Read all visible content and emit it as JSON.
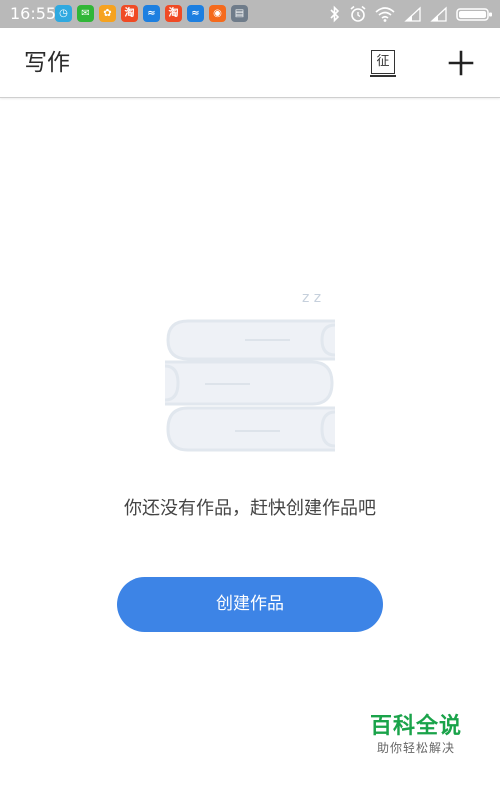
{
  "status_bar": {
    "time": "16:55",
    "notifications": [
      {
        "icon": "clock-app-icon",
        "color": "#2fa9e0",
        "glyph": "◷"
      },
      {
        "icon": "wechat-icon",
        "color": "#30b637",
        "glyph": "✉"
      },
      {
        "icon": "wallet-app-icon",
        "color": "#f6a21f",
        "glyph": "✿"
      },
      {
        "icon": "taobao-icon",
        "color": "#f04a24",
        "glyph": "淘"
      },
      {
        "icon": "alipay-icon",
        "color": "#1d7fe0",
        "glyph": "≈"
      },
      {
        "icon": "taobao-icon",
        "color": "#f04a24",
        "glyph": "淘"
      },
      {
        "icon": "alipay-icon",
        "color": "#1d7fe0",
        "glyph": "≈"
      },
      {
        "icon": "shopping-app-icon",
        "color": "#f56a1c",
        "glyph": "◉"
      },
      {
        "icon": "calculator-icon",
        "color": "#6f7c8a",
        "glyph": "▤"
      }
    ],
    "system_icons": [
      "bluetooth-icon",
      "alarm-icon",
      "wifi-icon",
      "signal-icon",
      "signal-icon",
      "battery-icon"
    ]
  },
  "header": {
    "title": "写作",
    "contest_glyph": "征"
  },
  "empty_state": {
    "sleep_glyph": "z z",
    "message": "你还没有作品，赶快创建作品吧",
    "button_label": "创建作品"
  },
  "watermark": {
    "title": "百科全说",
    "subtitle": "助你轻松解决"
  },
  "colors": {
    "status_bar": "#b9b9b9",
    "accent": "#3d84e6",
    "watermark": "#1aa34a",
    "illustration": "#eef1f6"
  }
}
